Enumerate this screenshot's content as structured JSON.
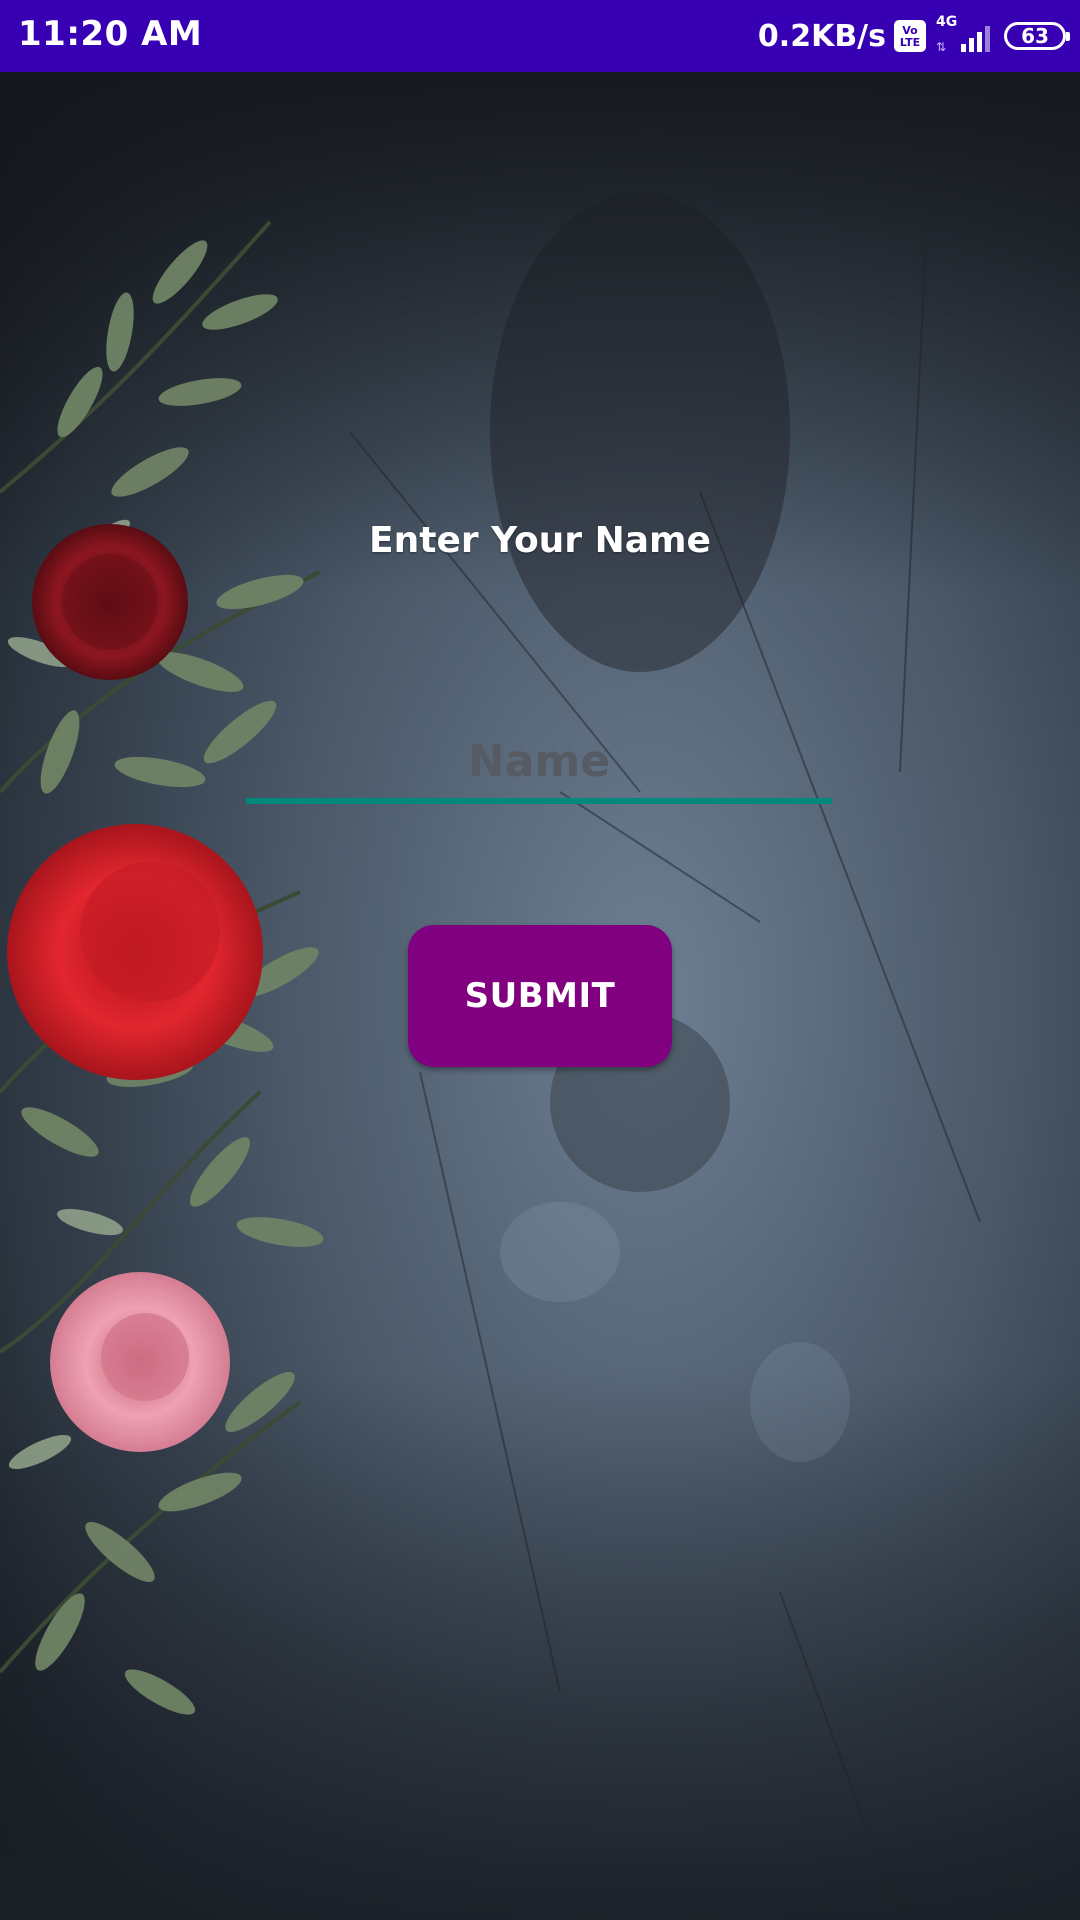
{
  "status_bar": {
    "time": "11:20 AM",
    "net_speed": "0.2KB/s",
    "volte_label": "Vo LTE",
    "network_type": "4G",
    "battery_level": "63",
    "background_color": "#3700b3"
  },
  "background": {
    "description_icon": "rose-flower-wallpaper"
  },
  "form": {
    "heading": "Enter Your Name",
    "name_placeholder": "Name",
    "name_value": "",
    "submit_label": "SUBMIT",
    "accent_color": "#00897b",
    "button_color": "#800080"
  }
}
